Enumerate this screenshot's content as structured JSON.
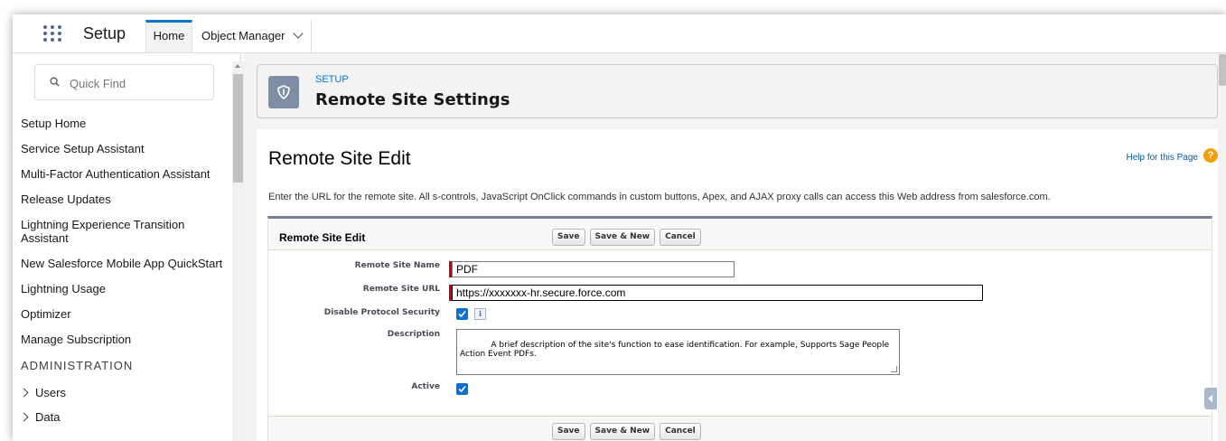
{
  "header": {
    "app_name": "Setup",
    "tabs": [
      {
        "label": "Home"
      },
      {
        "label": "Object Manager"
      }
    ]
  },
  "sidebar": {
    "search_placeholder": "Quick Find",
    "items": [
      {
        "label": "Setup Home"
      },
      {
        "label": "Service Setup Assistant"
      },
      {
        "label": "Multi-Factor Authentication Assistant"
      },
      {
        "label": "Release Updates"
      },
      {
        "label": "Lightning Experience Transition Assistant"
      },
      {
        "label": "New Salesforce Mobile App QuickStart"
      },
      {
        "label": "Lightning Usage"
      },
      {
        "label": "Optimizer"
      },
      {
        "label": "Manage Subscription"
      }
    ],
    "section_label": "ADMINISTRATION",
    "expandables": [
      {
        "label": "Users"
      },
      {
        "label": "Data"
      }
    ]
  },
  "page_header": {
    "eyebrow": "SETUP",
    "title": "Remote Site Settings"
  },
  "panel": {
    "title": "Remote Site Edit",
    "help_link": "Help for this Page",
    "intro": "Enter the URL for the remote site. All s-controls, JavaScript OnClick commands in custom buttons, Apex, and AJAX proxy calls can access this Web address from salesforce.com.",
    "block_title": "Remote Site Edit",
    "buttons": {
      "save": "Save",
      "save_new": "Save & New",
      "cancel": "Cancel"
    }
  },
  "form": {
    "name_label": "Remote Site Name",
    "name_value": "PDF",
    "url_label": "Remote Site URL",
    "url_value": "https://xxxxxxx-hr.secure.force.com",
    "disable_label": "Disable Protocol Security",
    "disable_checked": true,
    "info_glyph": "i",
    "description_label": "Description",
    "description_value": "A brief description of the site's function to ease identification. For example, Supports Sage People\nAction Event PDFs.",
    "active_label": "Active",
    "active_checked": true
  },
  "colors": {
    "brand_blue": "#0176d3",
    "required_red": "#cc0000",
    "checkbox_blue": "#0b6fd6",
    "help_orange": "#f1a10d"
  },
  "icons": [
    "app-launcher-icon",
    "chevron-down-icon",
    "search-icon",
    "setup-shield-icon",
    "help-icon",
    "info-icon",
    "checkbox-check-icon"
  ]
}
